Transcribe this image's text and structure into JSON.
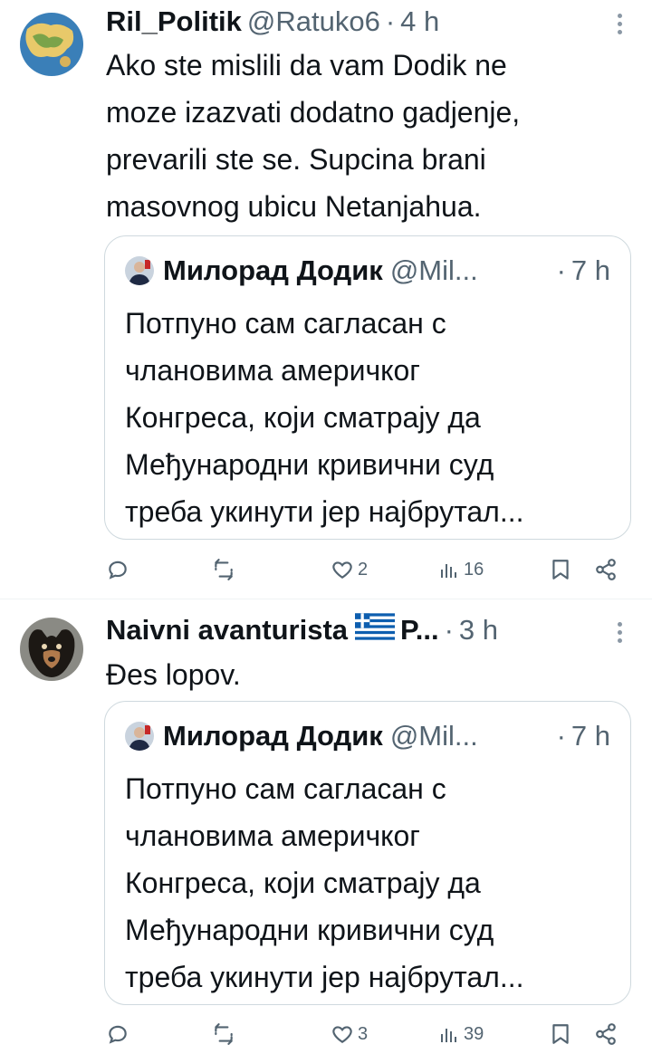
{
  "tweets": [
    {
      "author_name": "Ril_Politik",
      "handle": "@Ratuko6",
      "time": "4 h",
      "text_lines": [
        "Ako ste mislili da vam Dodik ne",
        "moze izazvati dodatno gadjenje,",
        "prevarili ste se. Supcina brani",
        "masovnog ubicu Netanjahua."
      ],
      "quote": {
        "author_name": "Милорад Додик",
        "handle": "@Mil...",
        "time": "7 h",
        "text_lines": [
          "Потпуно сам сагласан с",
          "члановима америчког",
          "Конгреса, који сматрају да",
          "Међународни кривични суд",
          "треба укинути јер најбрутал..."
        ]
      },
      "actions": {
        "replies": "",
        "reposts": "",
        "likes": "2",
        "views": "16"
      }
    },
    {
      "author_name": "Naivni avanturista",
      "handle_truncated": "P...",
      "time": "3 h",
      "text_lines": [
        "Đes lopov."
      ],
      "quote": {
        "author_name": "Милорад Додик",
        "handle": "@Mil...",
        "time": "7 h",
        "text_lines": [
          "Потпуно сам сагласан с",
          "члановима америчког",
          "Конгреса, који сматрају да",
          "Међународни кривични суд",
          "треба укинути јер најбрутал..."
        ]
      },
      "actions": {
        "replies": "",
        "reposts": "",
        "likes": "3",
        "views": "39"
      }
    }
  ],
  "colors": {
    "text": "#0f1419",
    "secondary": "#536471",
    "border": "#cfd9de",
    "greek_flag_blue": "#0d5eaf"
  },
  "icons": [
    "reply-icon",
    "repost-icon",
    "like-icon",
    "views-icon",
    "bookmark-icon",
    "share-icon",
    "more-icon"
  ]
}
